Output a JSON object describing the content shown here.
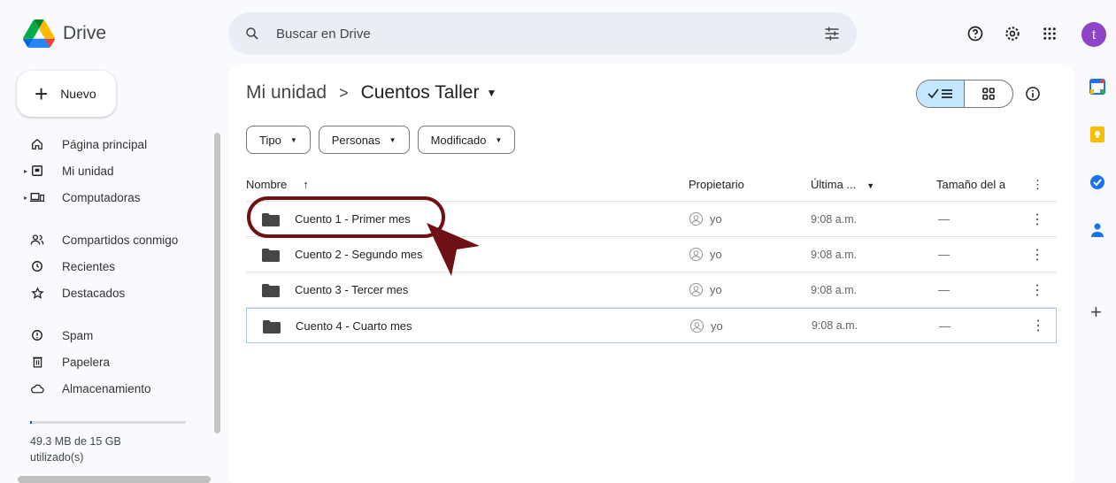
{
  "header": {
    "app_name": "Drive",
    "search_placeholder": "Buscar en Drive",
    "avatar_letter": "t"
  },
  "sidebar": {
    "new_label": "Nuevo",
    "items": [
      {
        "label": "Página principal",
        "icon": "home-icon"
      },
      {
        "label": "Mi unidad",
        "icon": "my-drive-icon"
      },
      {
        "label": "Computadoras",
        "icon": "computers-icon"
      },
      {
        "label": "Compartidos conmigo",
        "icon": "shared-icon"
      },
      {
        "label": "Recientes",
        "icon": "clock-icon"
      },
      {
        "label": "Destacados",
        "icon": "star-icon"
      },
      {
        "label": "Spam",
        "icon": "spam-icon"
      },
      {
        "label": "Papelera",
        "icon": "trash-icon"
      },
      {
        "label": "Almacenamiento",
        "icon": "cloud-icon"
      }
    ],
    "storage_text": "49.3 MB de 15 GB utilizado(s)",
    "storage_fraction": 0.0033
  },
  "main": {
    "breadcrumb_root": "Mi unidad",
    "breadcrumb_sep": ">",
    "breadcrumb_current": "Cuentos Taller",
    "filters": [
      "Tipo",
      "Personas",
      "Modificado"
    ],
    "columns": {
      "name": "Nombre",
      "owner": "Propietario",
      "modified": "Última ...",
      "size": "Tamaño del a"
    },
    "rows": [
      {
        "name": "Cuento 1 - Primer mes",
        "owner": "yo",
        "modified": "9:08 a.m.",
        "size": "—"
      },
      {
        "name": "Cuento 2 - Segundo mes",
        "owner": "yo",
        "modified": "9:08 a.m.",
        "size": "—"
      },
      {
        "name": "Cuento 3 - Tercer mes",
        "owner": "yo",
        "modified": "9:08 a.m.",
        "size": "—"
      },
      {
        "name": "Cuento 4 - Cuarto mes",
        "owner": "yo",
        "modified": "9:08 a.m.",
        "size": "—"
      }
    ]
  },
  "colors": {
    "accent": "#0b57d0",
    "annotation": "#6f0f16",
    "avatar": "#8e44c6"
  }
}
